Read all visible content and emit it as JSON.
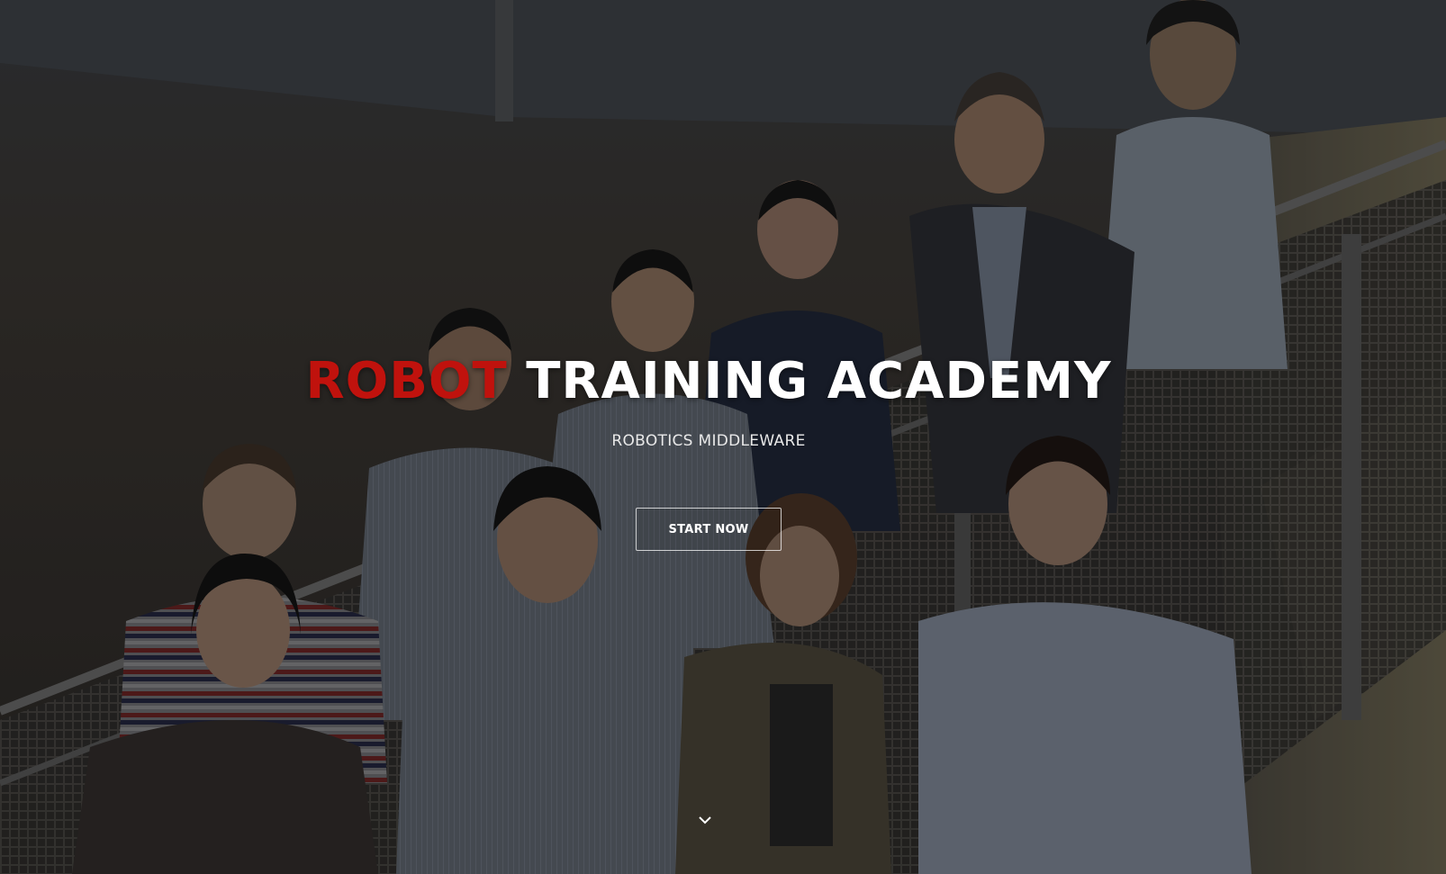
{
  "hero": {
    "title_accent": "ROBOT",
    "title_rest": "TRAINING ACADEMY",
    "subtitle": "ROBOTICS MIDDLEWARE",
    "cta_label": "START NOW",
    "scroll_icon": "chevron-down-icon",
    "background": "team-group-photo-on-staircase"
  },
  "colors": {
    "accent": "#c0120d",
    "title": "#ffffff",
    "subtitle": "#e8e8e8"
  }
}
